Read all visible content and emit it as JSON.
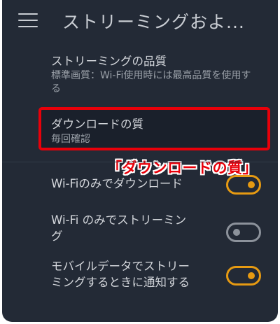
{
  "header": {
    "title": "ストリーミングおよ..."
  },
  "settings": [
    {
      "label": "ストリーミングの品質",
      "sub": "標準画質：Wi-Fi使用時には最高品質を使用する"
    },
    {
      "label": "ダウンロードの質",
      "sub": "毎回確認"
    },
    {
      "label": "Wi-Fiのみでダウンロード",
      "toggle": "on"
    },
    {
      "label_line1": "Wi-Fi のみでストリーミン",
      "label_line2": "グ",
      "toggle": "off"
    },
    {
      "label_line1": "モバイルデータでストリー",
      "label_line2": "ミングするときに通知する",
      "toggle": "on"
    }
  ],
  "annotation": {
    "callout": "「ダウンロードの質」"
  },
  "colors": {
    "background": "#232a36",
    "accent_toggle": "#e69a12",
    "highlight": "#e8000a"
  }
}
